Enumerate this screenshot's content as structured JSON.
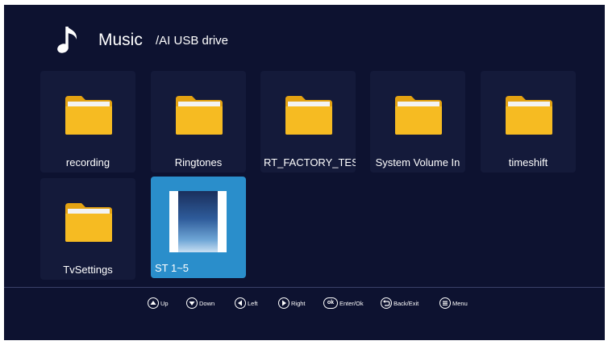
{
  "header": {
    "title": "Music",
    "path": "/AI USB drive",
    "icon": "music-note-icon"
  },
  "items": [
    {
      "label": "recording",
      "type": "folder"
    },
    {
      "label": "Ringtones",
      "type": "folder"
    },
    {
      "label": "RT_FACTORY_TES",
      "type": "folder"
    },
    {
      "label": "System Volume In",
      "type": "folder"
    },
    {
      "label": "timeshift",
      "type": "folder"
    },
    {
      "label": "TvSettings",
      "type": "folder"
    },
    {
      "label": "ST 1~5",
      "type": "audio-file",
      "selected": true
    }
  ],
  "hints": [
    {
      "label": "Up",
      "icon": "up-arrow-icon"
    },
    {
      "label": "Down",
      "icon": "down-arrow-icon"
    },
    {
      "label": "Left",
      "icon": "left-arrow-icon"
    },
    {
      "label": "Right",
      "icon": "right-arrow-icon"
    },
    {
      "label": "Enter/Ok",
      "icon": "ok-icon",
      "icon_text": "ok"
    },
    {
      "label": "Back/Exit",
      "icon": "back-icon"
    },
    {
      "label": "Menu",
      "icon": "menu-icon"
    }
  ],
  "colors": {
    "background": "#0d1230",
    "tile": "#141a3a",
    "selected": "#2a8ecb",
    "folder": "#f5b81c"
  }
}
